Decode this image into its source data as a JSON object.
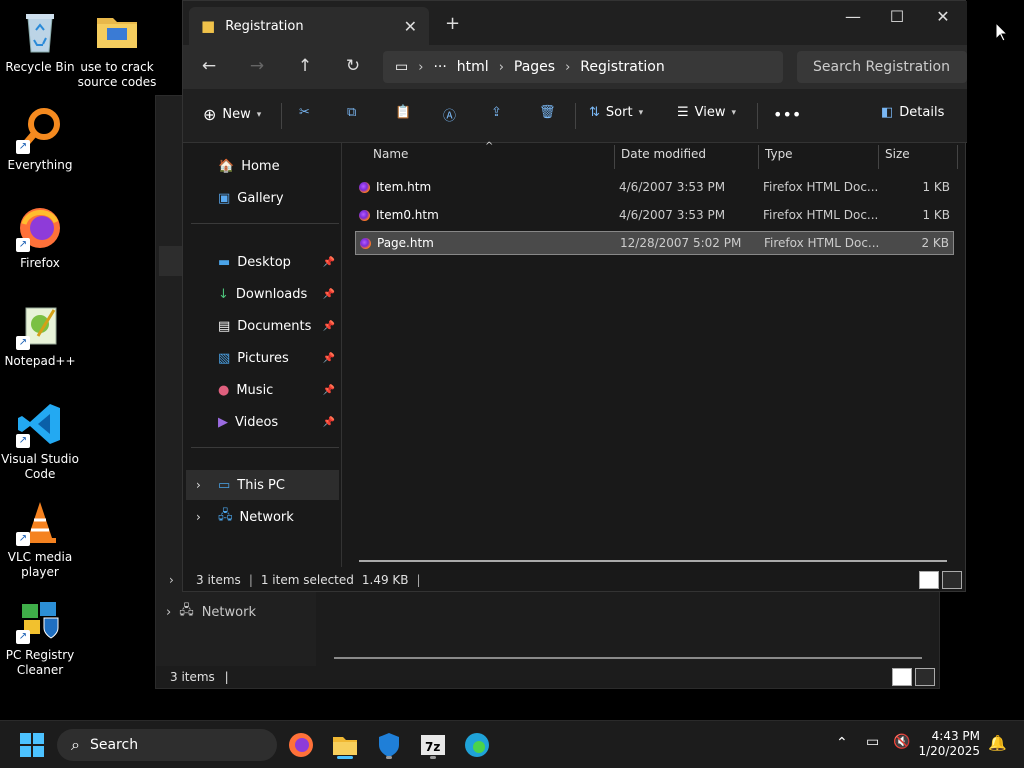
{
  "desktop": {
    "icons": [
      {
        "label": "Recycle Bin"
      },
      {
        "label": "use to crack source codes"
      },
      {
        "label": "Everything"
      },
      {
        "label": "Firefox"
      },
      {
        "label": "Notepad++"
      },
      {
        "label": "Visual Studio Code"
      },
      {
        "label": "VLC media player"
      },
      {
        "label": "PC Registry Cleaner"
      }
    ]
  },
  "bg_window": {
    "network_label": "Network",
    "status": "3 items"
  },
  "window": {
    "tab_title": "Registration",
    "breadcrumb": [
      "html",
      "Pages",
      "Registration"
    ],
    "search_placeholder": "Search Registration",
    "commands": {
      "new": "New",
      "sort": "Sort",
      "view": "View",
      "details": "Details"
    },
    "nav": {
      "home": "Home",
      "gallery": "Gallery",
      "desktop": "Desktop",
      "downloads": "Downloads",
      "documents": "Documents",
      "pictures": "Pictures",
      "music": "Music",
      "videos": "Videos",
      "this_pc": "This PC",
      "network": "Network"
    },
    "columns": {
      "name": "Name",
      "date": "Date modified",
      "type": "Type",
      "size": "Size"
    },
    "files": [
      {
        "name": "Item.htm",
        "date": "4/6/2007 3:53 PM",
        "type": "Firefox HTML Doc...",
        "size": "1 KB"
      },
      {
        "name": "Item0.htm",
        "date": "4/6/2007 3:53 PM",
        "type": "Firefox HTML Doc...",
        "size": "1 KB"
      },
      {
        "name": "Page.htm",
        "date": "12/28/2007 5:02 PM",
        "type": "Firefox HTML Doc...",
        "size": "2 KB"
      }
    ],
    "status": {
      "count": "3 items",
      "selected": "1 item selected",
      "size": "1.49 KB"
    }
  },
  "taskbar": {
    "search": "Search",
    "time": "4:43 PM",
    "date": "1/20/2025"
  }
}
